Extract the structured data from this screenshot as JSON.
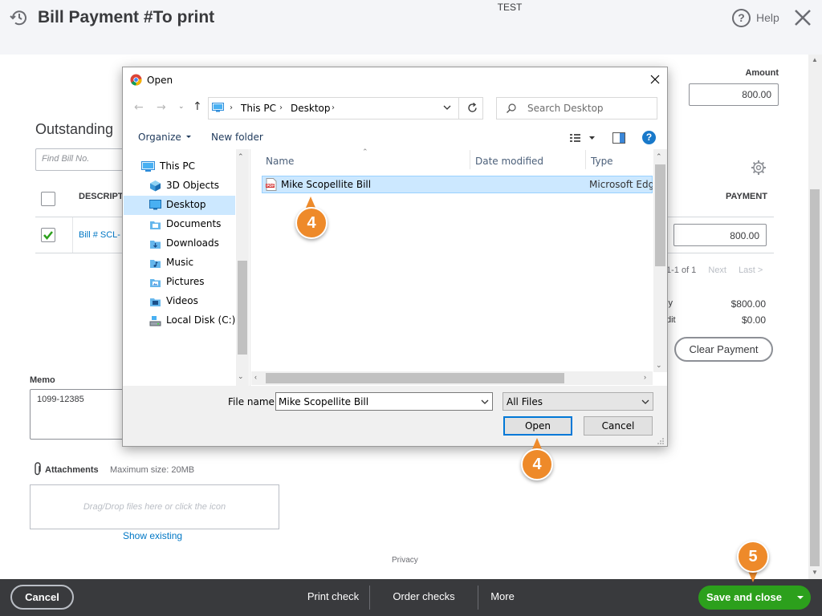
{
  "header": {
    "title": "Bill Payment #To print",
    "company": "TEST",
    "help_label": "Help",
    "history_icon": "history-icon",
    "close_icon": "close-icon"
  },
  "form": {
    "amount_label": "Amount",
    "amount_value": "800.00",
    "outstanding_title": "Outstanding",
    "find_bill_placeholder": "Find Bill No.",
    "table": {
      "columns": [
        "DESCRIPTI",
        "PAYMENT"
      ],
      "rows": [
        {
          "checked": true,
          "description": "Bill # SCL-",
          "payment": "800.00"
        }
      ]
    },
    "pagination": {
      "range": "1-1 of 1",
      "next": "Next",
      "last": "Last >"
    },
    "summary": [
      {
        "label": "ly",
        "value": "$800.00"
      },
      {
        "label": "dit",
        "value": "$0.00"
      }
    ],
    "clear_payment_label": "Clear Payment",
    "memo_label": "Memo",
    "memo_value": "1099-12385",
    "attachments_label": "Attachments",
    "max_size": "Maximum size: 20MB",
    "dropzone_text": "Drag/Drop files here or click the icon",
    "show_existing": "Show existing",
    "privacy": "Privacy"
  },
  "footer": {
    "cancel_label": "Cancel",
    "print_check_label": "Print check",
    "order_checks_label": "Order checks",
    "more_label": "More",
    "save_close_label": "Save and close"
  },
  "dialog": {
    "title": "Open",
    "breadcrumb": [
      "This PC",
      "Desktop"
    ],
    "search_placeholder": "Search Desktop",
    "organize_label": "Organize",
    "new_folder_label": "New folder",
    "nav_items": [
      {
        "label": "This PC",
        "icon": "pc-icon"
      },
      {
        "label": "3D Objects",
        "icon": "cube-icon"
      },
      {
        "label": "Desktop",
        "icon": "desktop-folder-icon",
        "selected": true
      },
      {
        "label": "Documents",
        "icon": "documents-folder-icon"
      },
      {
        "label": "Downloads",
        "icon": "downloads-folder-icon"
      },
      {
        "label": "Music",
        "icon": "music-folder-icon"
      },
      {
        "label": "Pictures",
        "icon": "pictures-folder-icon"
      },
      {
        "label": "Videos",
        "icon": "videos-folder-icon"
      },
      {
        "label": "Local Disk (C:)",
        "icon": "disk-icon"
      }
    ],
    "columns": {
      "name": "Name",
      "date": "Date modified",
      "type": "Type"
    },
    "files": [
      {
        "name": "Mike Scopellite Bill",
        "type": "Microsoft Edge",
        "icon": "pdf-icon",
        "selected": true
      }
    ],
    "filename_label": "File name:",
    "filename_value": "Mike Scopellite Bill",
    "filetype_value": "All Files",
    "open_label": "Open",
    "cancel_label": "Cancel"
  },
  "callouts": [
    "4",
    "4",
    "5"
  ],
  "colors": {
    "qb_green": "#2ca01c",
    "qb_dark": "#393a3d",
    "link_blue": "#0077c5",
    "callout_orange": "#ee8a2a",
    "win_select": "#cce8ff"
  }
}
